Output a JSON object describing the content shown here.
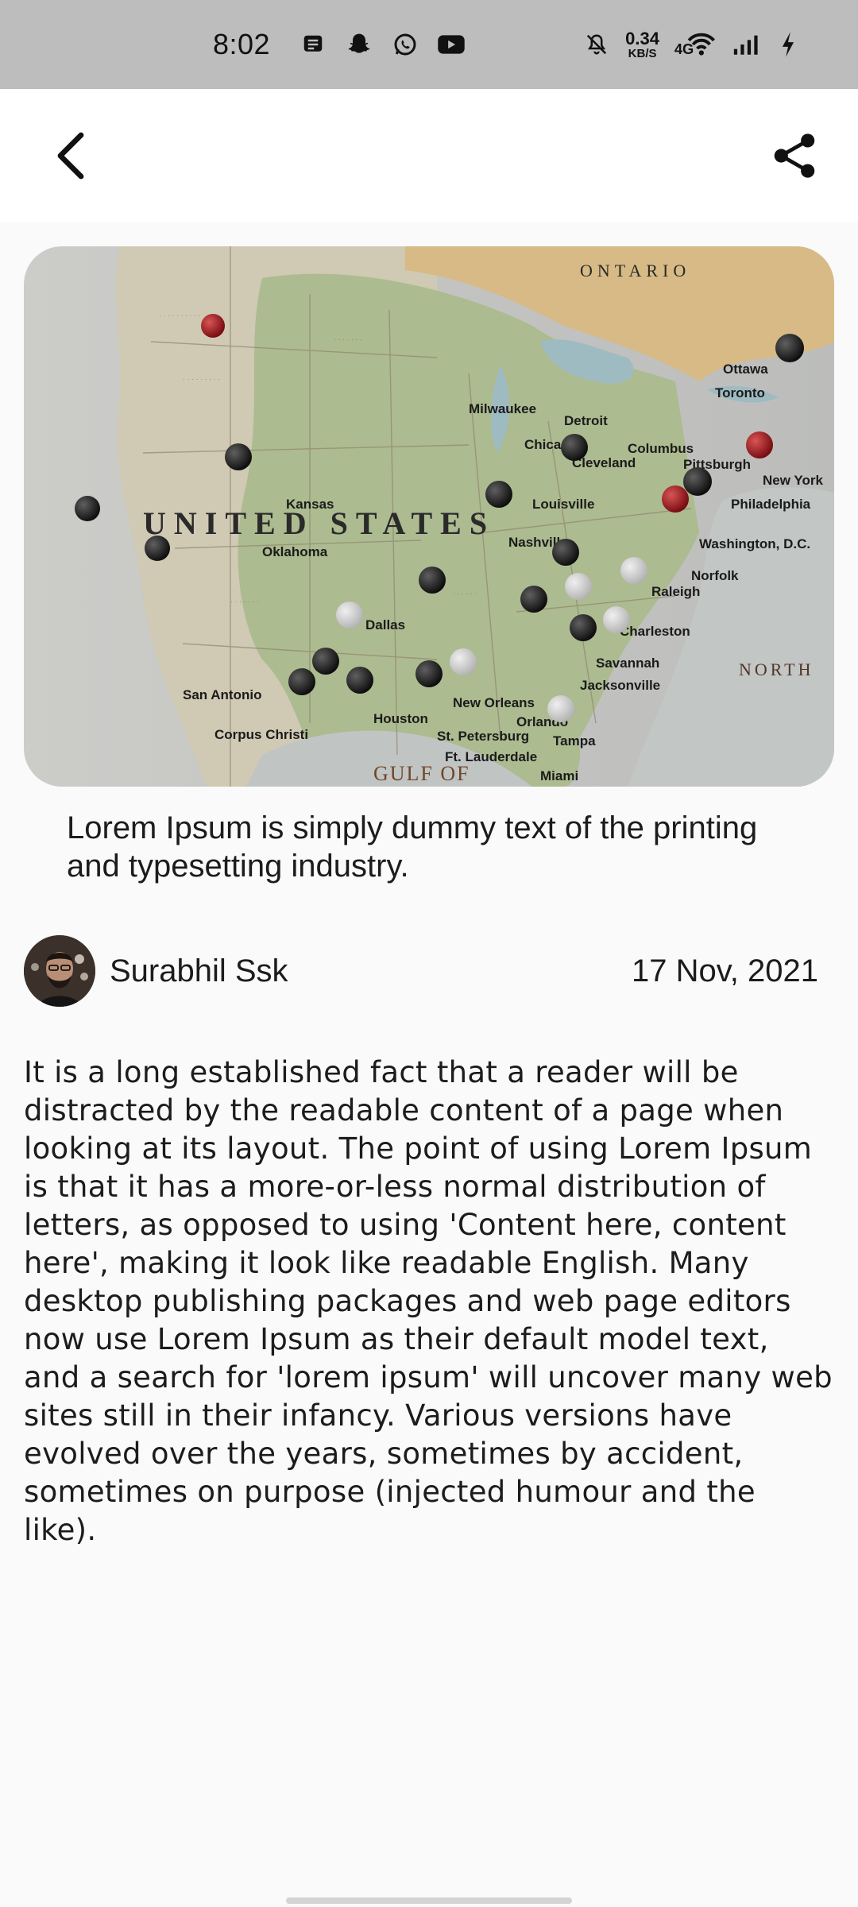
{
  "status_bar": {
    "time": "8:02",
    "net_speed_value": "0.34",
    "net_speed_unit": "KB/S",
    "network_type": "4G"
  },
  "article": {
    "caption": "Lorem Ipsum is simply dummy text of the printing and typesetting industry.",
    "author": "Surabhil Ssk",
    "date": "17 Nov, 2021",
    "body": "It is a long established fact that a reader will be distracted by the readable content of a page when looking at its layout. The point of using Lorem Ipsum is that it has a more-or-less normal distribution of letters, as opposed to using 'Content here, content here', making it look like readable English. Many desktop publishing packages and web page editors now use Lorem Ipsum as their default model text, and a search for 'lorem ipsum' will uncover many web sites still in their infancy. Various versions have evolved over the years, sometimes by accident, sometimes on purpose (injected humour and the like)."
  },
  "map_labels": {
    "country": "UNITED STATES",
    "ontario": "ONTARIO",
    "gulf": "GULF OF",
    "north": "NORTH",
    "cities": [
      "Chicago",
      "Cleveland",
      "Pittsburgh",
      "Toronto",
      "Ottawa",
      "Philadelphia",
      "New York",
      "Washington, D.C.",
      "Norfolk",
      "Dallas",
      "Houston",
      "New Orleans",
      "Orlando",
      "Tampa",
      "Miami",
      "Jacksonville",
      "Savannah",
      "Nashville",
      "Louisville",
      "Columbus",
      "Kansas",
      "Oklahoma",
      "San Antonio",
      "Corpus Christi",
      "St. Petersburg",
      "Ft. Lauderdale",
      "Milwaukee",
      "Detroit",
      "Charleston",
      "Raleigh"
    ]
  },
  "icons": {
    "back": "chevron-left-icon",
    "share": "share-icon"
  }
}
